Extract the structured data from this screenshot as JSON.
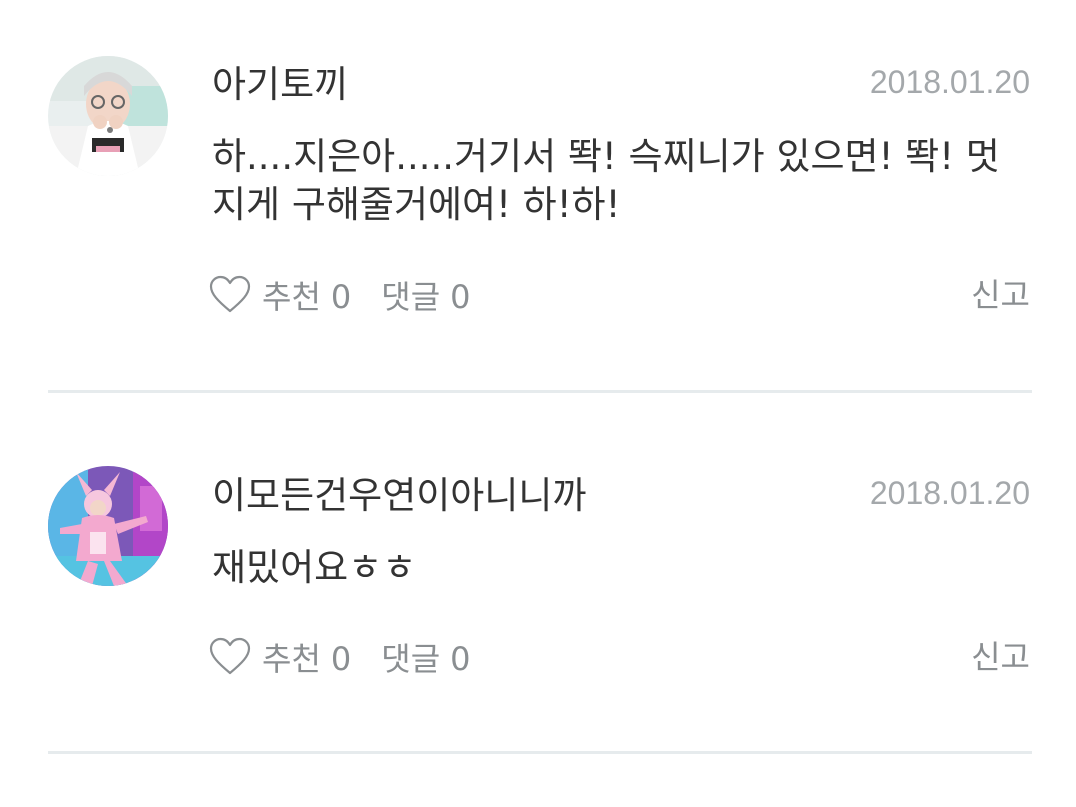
{
  "comments": [
    {
      "author": "아기토끼",
      "date": "2018.01.20",
      "text": "하....지은아.....거기서 똭! 슥찌니가 있으면! 똭! 멋지게 구해줄거에여! 하!하!",
      "like_label": "추천",
      "like_count": "0",
      "reply_label": "댓글",
      "reply_count": "0",
      "report_label": "신고"
    },
    {
      "author": "이모든건우연이아니니까",
      "date": "2018.01.20",
      "text": "재밌어요ㅎㅎ",
      "like_label": "추천",
      "like_count": "0",
      "reply_label": "댓글",
      "reply_count": "0",
      "report_label": "신고"
    }
  ],
  "icons": {
    "like": "heart-outline-icon"
  },
  "colors": {
    "text": "#333333",
    "meta": "#a4a8ab",
    "action": "#8a8e91",
    "divider": "#e6ebed"
  }
}
